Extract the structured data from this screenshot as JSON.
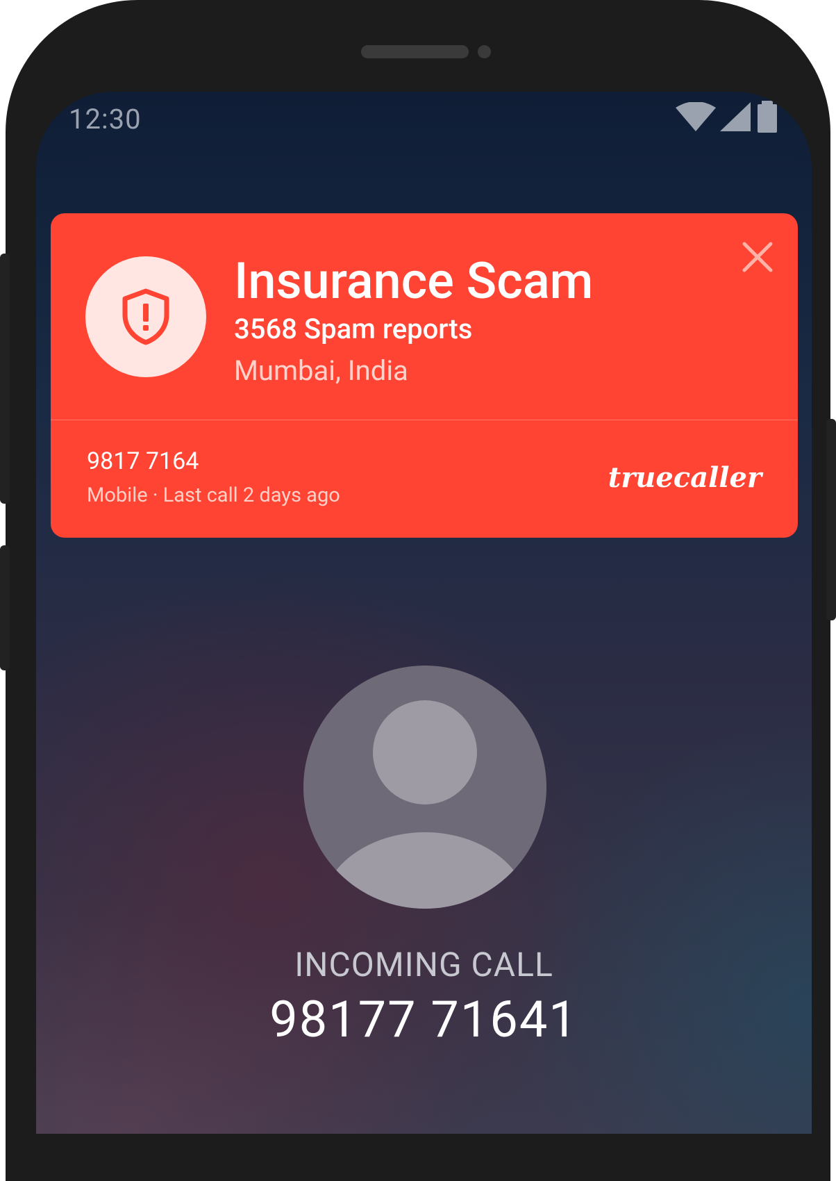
{
  "status_bar": {
    "time": "12:30",
    "icons": [
      "wifi-icon",
      "signal-icon",
      "battery-icon"
    ]
  },
  "caller_id_card": {
    "icon": "shield-alert-icon",
    "title": "Insurance Scam",
    "spam_reports": "3568 Spam reports",
    "location": "Mumbai, India",
    "number": "9817 7164",
    "meta": "Mobile · Last call 2 days ago",
    "brand": "truecaller",
    "close_icon": "close-icon",
    "color": "#ff4433"
  },
  "call_screen": {
    "avatar_icon": "person-avatar-icon",
    "label": "INCOMING CALL",
    "number": "98177 71641"
  }
}
